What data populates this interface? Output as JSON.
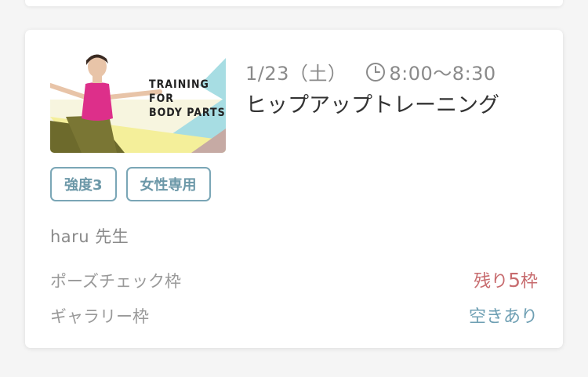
{
  "lesson": {
    "thumbnail": {
      "caption_lines": [
        "TRAINING",
        "FOR",
        "BODY PARTS"
      ],
      "colors": {
        "olive": "#6d6a2c",
        "pink": "#dd2f8a",
        "cyan": "#a7dde3",
        "yellow": "#f4ef9a",
        "mauve": "#c6aaa4"
      }
    },
    "date": "1/23（土）",
    "time": "8:00〜8:30",
    "title": "ヒップアップトレーニング",
    "tags": [
      "強度3",
      "女性専用"
    ],
    "teacher": "haru 先生",
    "slots": [
      {
        "label": "ポーズチェック枠",
        "status_prefix": "残り",
        "status_number": "5",
        "status_suffix": "枠",
        "status_color": "#c76b6e"
      },
      {
        "label": "ギャラリー枠",
        "status": "空きあり",
        "status_color": "#6e9fb3"
      }
    ]
  }
}
